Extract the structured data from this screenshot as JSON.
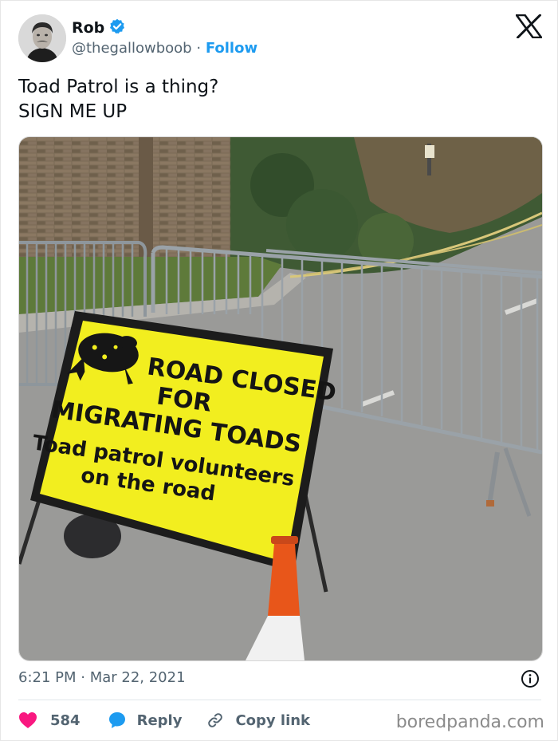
{
  "author": {
    "name": "Rob",
    "handle": "@thegallowboob",
    "separator": "·",
    "follow_label": "Follow",
    "verified": true
  },
  "tweet": {
    "lines": [
      "Toad Patrol is a thing?",
      "SIGN ME UP"
    ]
  },
  "photo": {
    "sign_lines": [
      "ROAD CLOSED",
      "FOR",
      "MIGRATING TOADS",
      "Toad patrol volunteers",
      "on the road"
    ]
  },
  "meta": {
    "timestamp": "6:21 PM · Mar 22, 2021"
  },
  "actions": {
    "likes": "584",
    "reply_label": "Reply",
    "copy_link_label": "Copy link"
  },
  "watermark": "boredpanda.com",
  "colors": {
    "accent": "#1d9bf0",
    "like": "#f91880",
    "sign_yellow": "#f2ee1f",
    "cone_orange": "#e8561a"
  },
  "icons": [
    "verified-badge-icon",
    "x-logo-icon",
    "info-icon",
    "heart-icon",
    "reply-bubble-icon",
    "link-icon"
  ]
}
